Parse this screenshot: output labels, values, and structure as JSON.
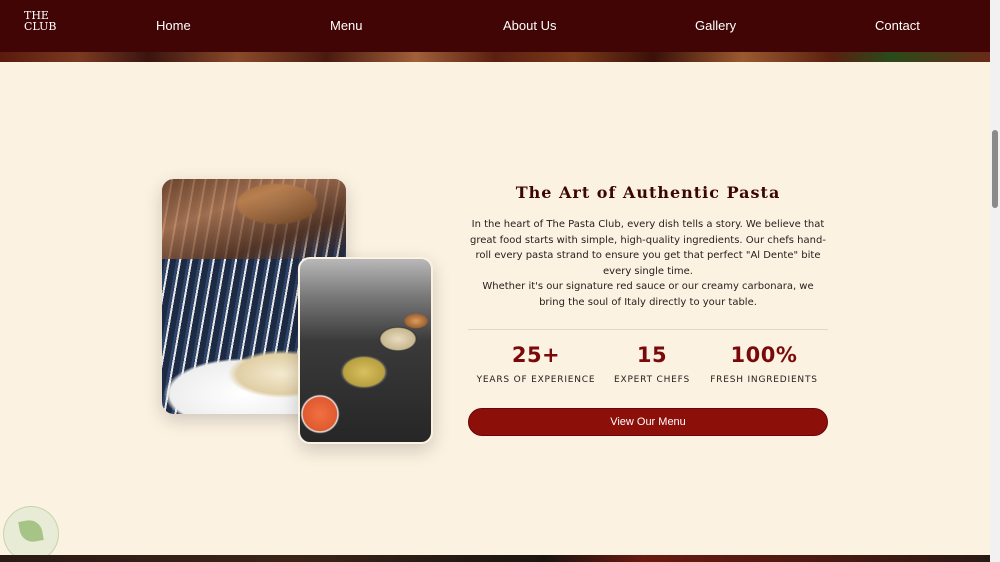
{
  "nav": {
    "logo_top": "THE",
    "logo_bottom": "CLUB",
    "links": [
      "Home",
      "Menu",
      "About Us",
      "Gallery",
      "Contact"
    ]
  },
  "about": {
    "title": "The Art of Authentic Pasta",
    "paragraph_1": "In the heart of The Pasta Club, every dish tells a story. We believe that great food starts with simple, high-quality ingredients. Our chefs hand-roll every pasta strand to ensure you get that perfect \"Al Dente\" bite every single time.",
    "paragraph_2": "Whether it's our signature red sauce or our creamy carbonara, we bring the soul of Italy directly to your table.",
    "stats": [
      {
        "value": "25+",
        "label": "YEARS OF EXPERIENCE"
      },
      {
        "value": "15",
        "label": "EXPERT CHEFS"
      },
      {
        "value": "100%",
        "label": "FRESH INGREDIENTS"
      }
    ],
    "cta_label": "View Our Menu"
  },
  "images": {
    "main_icon": "cheese-grating-photo",
    "secondary_icon": "kitchen-pans-photo"
  },
  "colors": {
    "nav_bg": "#420505",
    "page_bg": "#fcf2e2",
    "accent": "#8c0f0a",
    "heading": "#3a0606"
  }
}
